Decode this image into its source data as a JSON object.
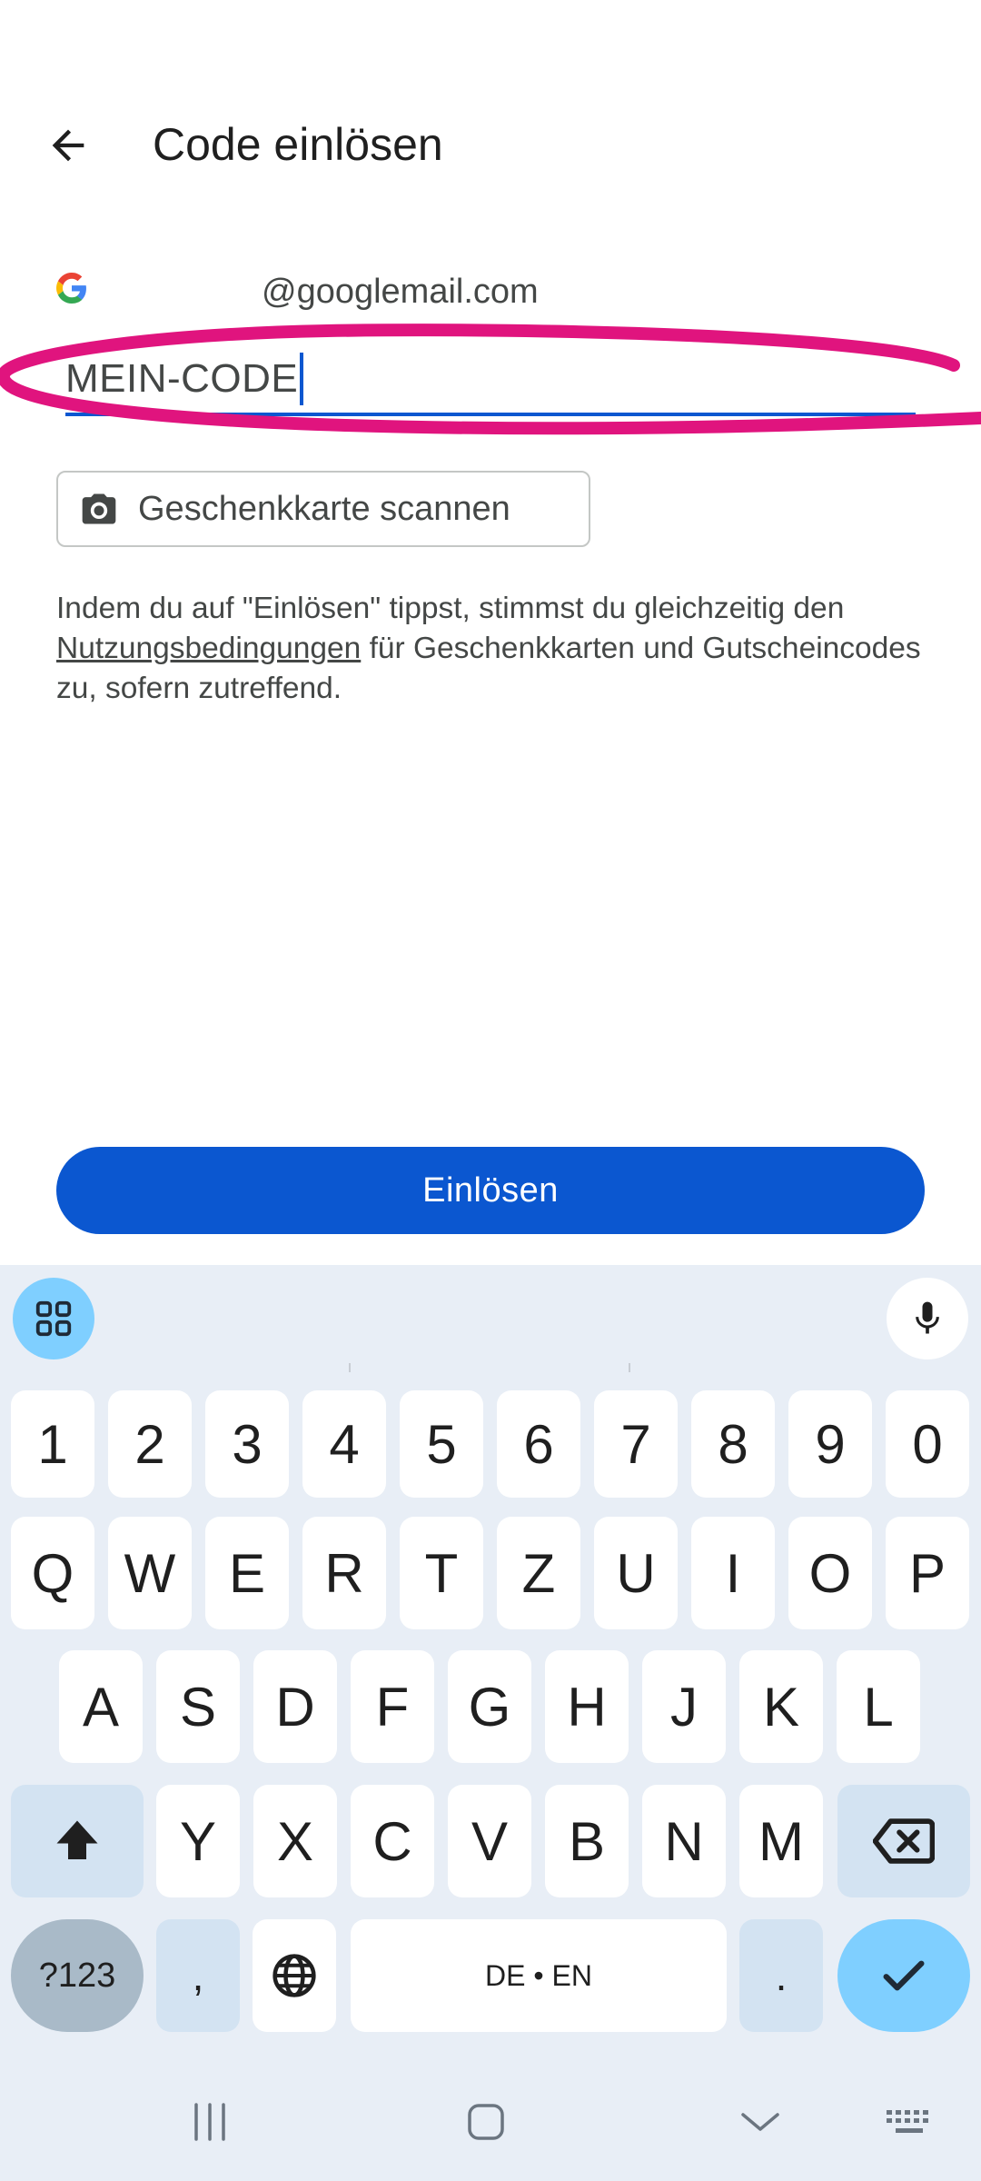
{
  "appbar": {
    "title": "Code einlösen",
    "back_icon": "arrow-left-icon"
  },
  "account": {
    "email": "@googlemail.com",
    "logo": "google-g-logo"
  },
  "code_field": {
    "value": "MEIN-CODE"
  },
  "scan_button": {
    "label": "Geschenkkarte scannen",
    "icon": "camera-icon"
  },
  "terms": {
    "before": "Indem du auf \"Einlösen\" tippst, stimmst du gleichzeitig den ",
    "link": "Nutzungsbedingungen",
    "after": " für Geschenkkarten und Gutscheincodes zu, sofern zutreffend."
  },
  "redeem_button": {
    "label": "Einlösen"
  },
  "keyboard": {
    "row_numbers": [
      "1",
      "2",
      "3",
      "4",
      "5",
      "6",
      "7",
      "8",
      "9",
      "0"
    ],
    "row_q": [
      "Q",
      "W",
      "E",
      "R",
      "T",
      "Z",
      "U",
      "I",
      "O",
      "P"
    ],
    "row_a": [
      "A",
      "S",
      "D",
      "F",
      "G",
      "H",
      "J",
      "K",
      "L"
    ],
    "row_y": [
      "Y",
      "X",
      "C",
      "V",
      "B",
      "N",
      "M"
    ],
    "symbols_label": "?123",
    "comma": ",",
    "space_label": "DE • EN",
    "period": ".",
    "icons": {
      "menu": "grid-icon",
      "mic": "microphone-icon",
      "shift": "shift-icon",
      "backspace": "backspace-icon",
      "globe": "globe-icon",
      "enter": "checkmark-icon"
    }
  },
  "colors": {
    "accent": "#0b57d0",
    "annotation": "#e0147e",
    "keyboard_bg": "#e8eef6",
    "enter_key": "#7fcfff"
  }
}
